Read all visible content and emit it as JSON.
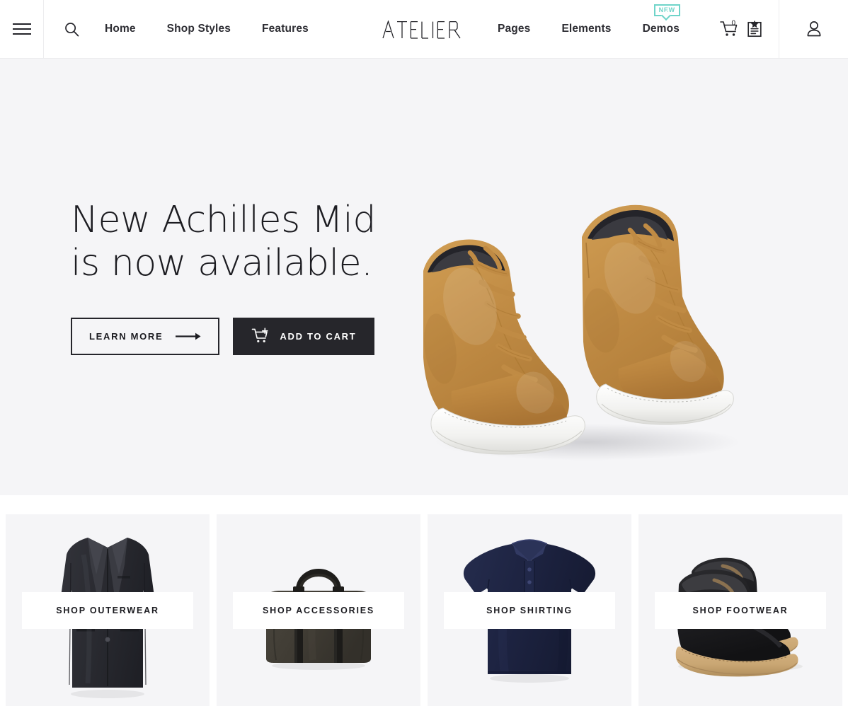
{
  "header": {
    "menu_icon": "hamburger-menu-icon",
    "search_icon": "search-icon",
    "logo": "ATELIER",
    "nav_left": [
      {
        "label": "Home"
      },
      {
        "label": "Shop Styles"
      },
      {
        "label": "Features"
      }
    ],
    "nav_right": [
      {
        "label": "Pages"
      },
      {
        "label": "Elements"
      },
      {
        "label": "Demos",
        "badge": "NEW"
      }
    ],
    "cart": {
      "icon": "shopping-cart-icon",
      "count": "0"
    },
    "wishlist": {
      "icon": "wishlist-clipboard-star-icon"
    },
    "account": {
      "icon": "user-account-icon"
    },
    "badge_color": "#6fd4c9"
  },
  "hero": {
    "title": "New Achilles Mid\nis now available.",
    "primary_button": {
      "label": "LEARN MORE",
      "icon": "arrow-right-icon"
    },
    "secondary_button": {
      "label": "ADD TO CART",
      "icon": "cart-plus-icon"
    },
    "product_image": "tan-suede-mid-top-sneakers",
    "background_color": "#f5f5f7"
  },
  "categories": [
    {
      "label": "SHOP OUTERWEAR",
      "art": "charcoal-overcoat"
    },
    {
      "label": "SHOP ACCESSORIES",
      "art": "olive-briefcase-bag"
    },
    {
      "label": "SHOP SHIRTING",
      "art": "navy-polo-shirt"
    },
    {
      "label": "SHOP FOOTWEAR",
      "art": "black-leather-boots"
    }
  ]
}
